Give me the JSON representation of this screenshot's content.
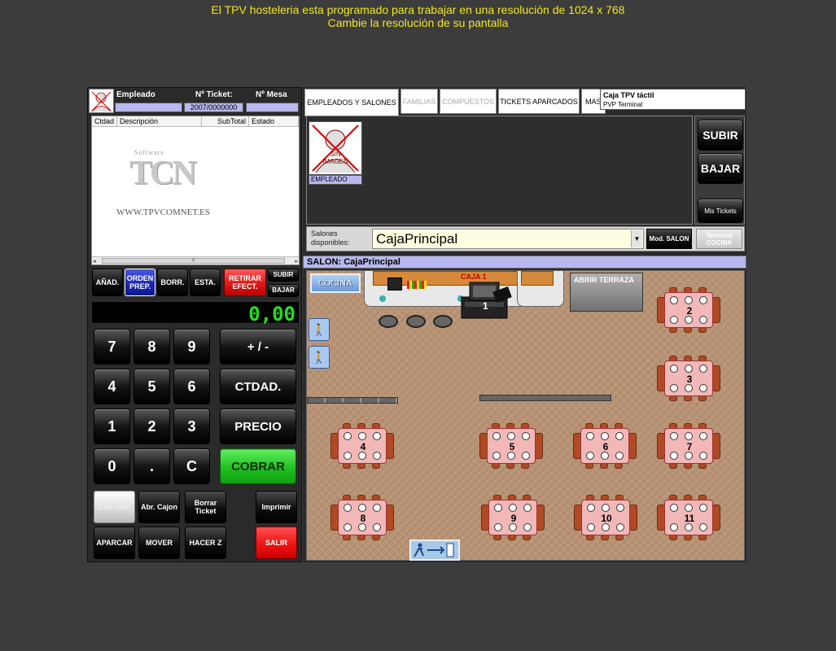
{
  "notice": {
    "line1": "El TPV hosteleria esta programado para trabajar en una resolución de 1024 x 768",
    "line2": "Cambie la resolución de su pantalla"
  },
  "ticket_header": {
    "empleado_label": "Empleado",
    "ticket_label": "Nº Ticket:",
    "mesa_label": "Nº Mesa",
    "ticket_value": "2007/0000000"
  },
  "ticket_columns": [
    "Ctdad",
    "Descripción",
    "SubTotal",
    "Estado"
  ],
  "logo": {
    "software": "Software",
    "brand": "TCN",
    "url": "WWW.TPVCOMNET.ES"
  },
  "action_buttons": {
    "anadir": "AÑAD.",
    "orden": "ORDEN PREP.",
    "borr": "BORR.",
    "esta": "ESTA.",
    "retirar": "RETIRAR EFECT.",
    "subir": "SUBIR",
    "bajar": "BAJAR"
  },
  "display_value": "0,00",
  "keypad": {
    "digits": [
      "7",
      "8",
      "9",
      "4",
      "5",
      "6",
      "1",
      "2",
      "3",
      "0",
      ".",
      "C"
    ],
    "plusminus": "+ / -",
    "ctdad": "CTDAD.",
    "precio": "PRECIO",
    "cobrar": "COBRAR"
  },
  "bottom_buttons": {
    "cod_bar": "Cód. Bar.",
    "abr_cajon": "Abr. Cajon",
    "borrar_ticket": "Borrar Ticket",
    "imprimir": "Imprimir",
    "aparcar": "APARCAR",
    "mover": "MOVER",
    "hacer_z": "HACER Z",
    "salir": "SALIR"
  },
  "tabs": [
    {
      "label": "EMPLEADOS Y SALONES",
      "state": "selected"
    },
    {
      "label": "FAMILIAS",
      "state": "disabled"
    },
    {
      "label": "COMPUESTOS",
      "state": "disabled"
    },
    {
      "label": "TICKETS APARCADOS",
      "state": "normal"
    },
    {
      "label": "MAS",
      "state": "normal"
    }
  ],
  "caja": {
    "title": "Caja TPV táctil",
    "subtitle": "PVP Terminal"
  },
  "employee": {
    "image_text": "SIN IMAGEN",
    "label": "EMPLEADO"
  },
  "side_buttons": {
    "subir": "SUBIR",
    "bajar": "BAJAR",
    "mis_tickets": "Mis Tickets"
  },
  "salones": {
    "label": "Salones disponibles:",
    "selected": "CajaPrincipal",
    "mod_salon": "Mod. SALON",
    "terminal_cocina": "Terminal COCINA"
  },
  "salon_title": "SALON: CajaPrincipal",
  "floor": {
    "cocina": "COCINA",
    "caja": "CAJA 1",
    "register_number": "1",
    "abrir_terraza": "ABRIR TERRAZA",
    "tables": [
      "2",
      "3",
      "4",
      "5",
      "6",
      "7",
      "8",
      "9",
      "10",
      "11"
    ]
  },
  "colors": {
    "notice": "#f2e61a",
    "display_digits": "#20e020",
    "cobrar": "#20c020",
    "retirar": "#e01818",
    "salir": "#ee1414",
    "orden": "#2030c0",
    "label_bg": "#b8b8ee",
    "floor": "#b89374"
  }
}
